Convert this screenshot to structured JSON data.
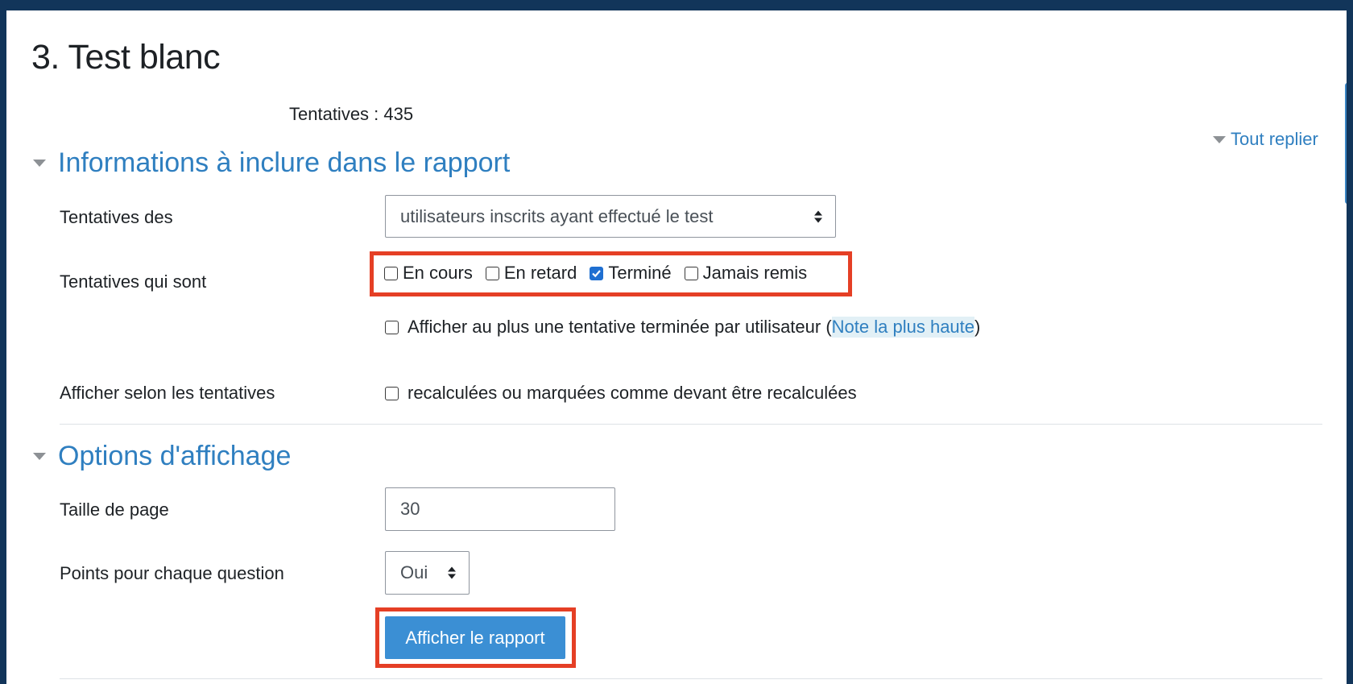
{
  "page": {
    "title": "3. Test blanc",
    "attempts_text": "Tentatives : 435",
    "collapse_all": "Tout replier"
  },
  "section_report": {
    "heading": "Informations à inclure dans le rapport",
    "attempts_from_label": "Tentatives des",
    "attempts_from_value": "utilisateurs inscrits ayant effectué le test",
    "attempts_that_are_label": "Tentatives qui sont",
    "states": [
      {
        "label": "En cours",
        "checked": false
      },
      {
        "label": "En retard",
        "checked": false
      },
      {
        "label": "Terminé",
        "checked": true
      },
      {
        "label": "Jamais remis",
        "checked": false
      }
    ],
    "only_one_prefix": "Afficher au plus une tentative terminée par utilisateur (",
    "only_one_link": "Note la plus haute",
    "only_one_suffix": ")",
    "show_by_label": "Afficher selon les tentatives",
    "regraded_label": "recalculées ou marquées comme devant être recalculées"
  },
  "section_display": {
    "heading": "Options d'affichage",
    "page_size_label": "Taille de page",
    "page_size_value": "30",
    "marks_label": "Points pour chaque question",
    "marks_value": "Oui",
    "submit_label": "Afficher le rapport"
  },
  "colors": {
    "accent": "#2f7fc0",
    "button": "#3b8fd4",
    "highlight_box": "#e53f25",
    "checkbox_checked": "#1f6fd1",
    "background_frame": "#12355a"
  }
}
